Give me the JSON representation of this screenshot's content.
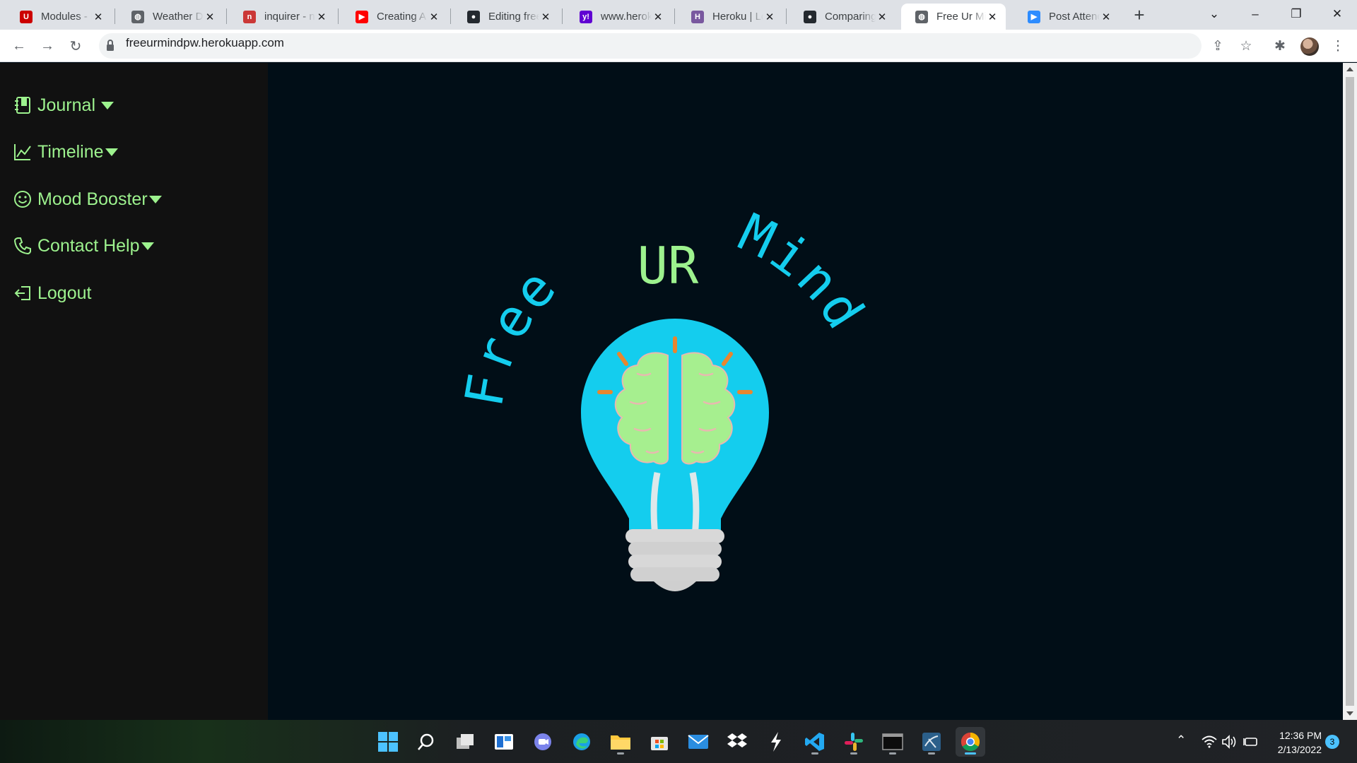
{
  "browser": {
    "tabs": [
      {
        "title": "Modules - E",
        "favicon": "utah-u-icon",
        "color": "#cc0000"
      },
      {
        "title": "Weather Da",
        "favicon": "globe-icon",
        "color": "#5f6368"
      },
      {
        "title": "inquirer - n",
        "favicon": "npm-icon",
        "color": "#cb3837"
      },
      {
        "title": "Creating A",
        "favicon": "youtube-icon",
        "color": "#ff0000"
      },
      {
        "title": "Editing free",
        "favicon": "github-icon",
        "color": "#24292f"
      },
      {
        "title": "www.herok",
        "favicon": "yahoo-icon",
        "color": "#6001d2"
      },
      {
        "title": "Heroku | Lo",
        "favicon": "heroku-icon",
        "color": "#79589f"
      },
      {
        "title": "Comparing",
        "favicon": "github-icon",
        "color": "#24292f"
      },
      {
        "title": "Free Ur Min",
        "favicon": "globe-icon",
        "color": "#5f6368"
      },
      {
        "title": "Post Attend",
        "favicon": "zoom-icon",
        "color": "#2d8cff"
      }
    ],
    "url": "freeurmindpw.herokuapp.com"
  },
  "sidebar": {
    "items": [
      {
        "label": "Journal",
        "icon": "journal-icon",
        "dropdown": true
      },
      {
        "label": "Timeline",
        "icon": "chart-line-icon",
        "dropdown": true
      },
      {
        "label": "Mood Booster",
        "icon": "smiley-icon",
        "dropdown": true
      },
      {
        "label": "Contact Help",
        "icon": "phone-icon",
        "dropdown": true
      },
      {
        "label": "Logout",
        "icon": "logout-icon",
        "dropdown": false
      }
    ]
  },
  "logo": {
    "word_left": "Free",
    "word_top": "UR",
    "word_right": "Mind"
  },
  "taskbar": {
    "time": "12:36 PM",
    "date": "2/13/2022",
    "notifications": "3"
  },
  "colors": {
    "accent_green": "#9df28e",
    "bulb_cyan": "#14cdee",
    "page_bg": "#010e17",
    "sidebar_bg": "#111111"
  }
}
